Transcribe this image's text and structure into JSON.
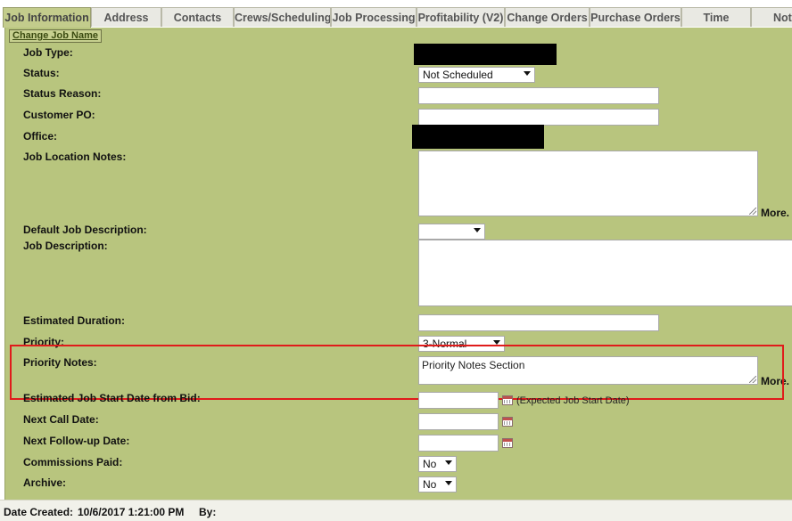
{
  "tabs": [
    {
      "label": "Job Information"
    },
    {
      "label": "Address"
    },
    {
      "label": "Contacts"
    },
    {
      "label": "Crews/Scheduling"
    },
    {
      "label": "Job Processing"
    },
    {
      "label": "Profitability (V2)"
    },
    {
      "label": "Change Orders"
    },
    {
      "label": "Purchase Orders"
    },
    {
      "label": "Time"
    },
    {
      "label": "Note"
    }
  ],
  "change_job_name_label": "Change Job Name",
  "fields": {
    "job_type": {
      "label": "Job Type:"
    },
    "status": {
      "label": "Status:",
      "value": "Not Scheduled"
    },
    "status_reason": {
      "label": "Status Reason:",
      "value": ""
    },
    "customer_po": {
      "label": "Customer PO:",
      "value": ""
    },
    "office": {
      "label": "Office:"
    },
    "job_location_notes": {
      "label": "Job Location Notes:",
      "value": "",
      "more": "More."
    },
    "default_job_description": {
      "label": "Default Job Description:",
      "value": ""
    },
    "job_description": {
      "label": "Job Description:",
      "value": ""
    },
    "estimated_duration": {
      "label": "Estimated Duration:",
      "value": ""
    },
    "priority": {
      "label": "Priority:",
      "value": "3-Normal"
    },
    "priority_notes": {
      "label": "Priority Notes:",
      "value": "Priority Notes Section",
      "more": "More."
    },
    "est_start_date": {
      "label": "Estimated Job Start Date from Bid:",
      "value": "",
      "hint": "(Expected Job Start Date)"
    },
    "next_call_date": {
      "label": "Next Call Date:",
      "value": ""
    },
    "next_followup_date": {
      "label": "Next Follow-up Date:",
      "value": ""
    },
    "commissions_paid": {
      "label": "Commissions Paid:",
      "value": "No"
    },
    "archive": {
      "label": "Archive:",
      "value": "No"
    }
  },
  "footer": {
    "date_created_label": "Date Created:",
    "date_created_value": "10/6/2017 1:21:00 PM",
    "by_label": "By:"
  },
  "colors": {
    "panel": "#b8c57e",
    "highlight": "#e01b1b",
    "active_tab": "#c3cc8c"
  }
}
